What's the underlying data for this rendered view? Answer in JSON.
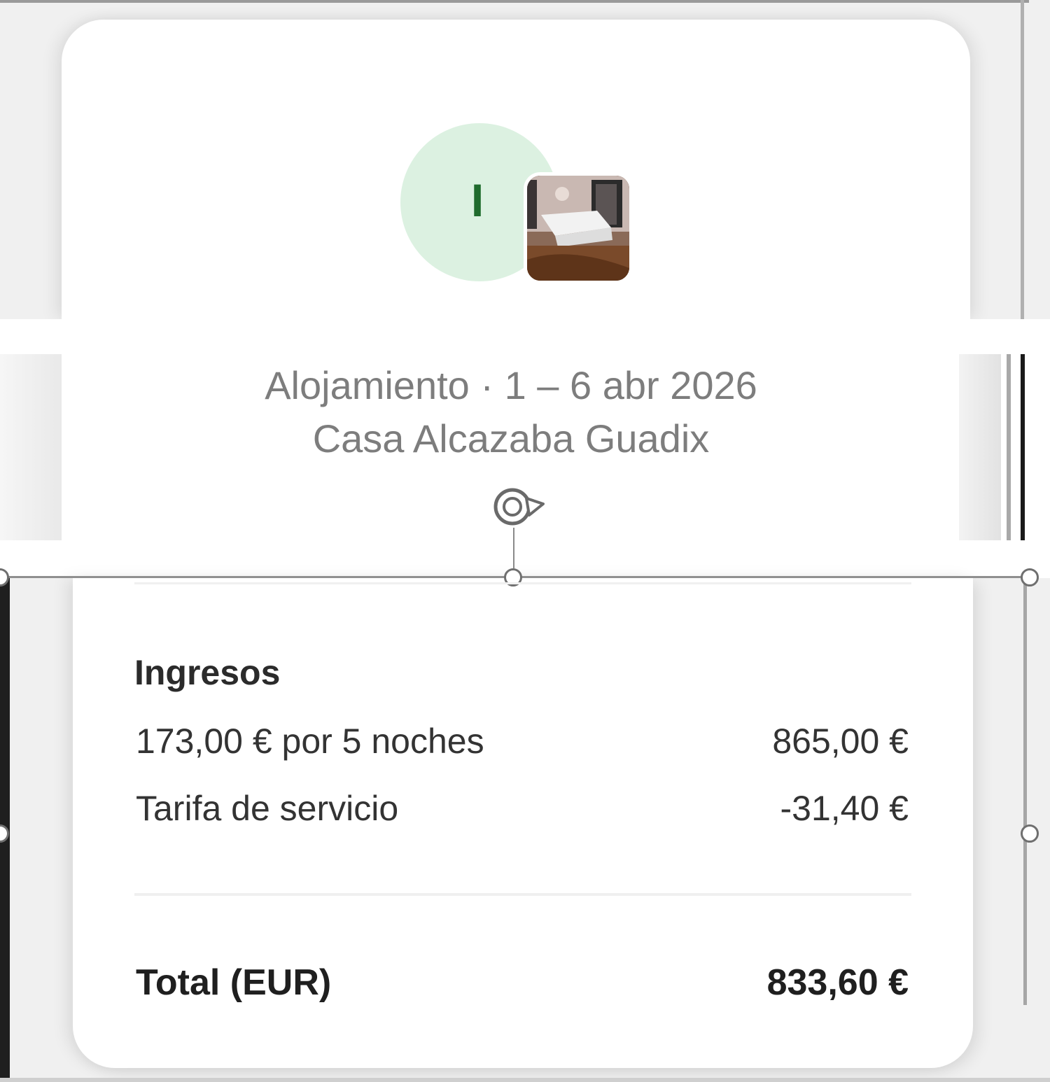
{
  "host": {
    "avatar_initial": "I"
  },
  "reservation": {
    "stay_label": "Alojamiento",
    "separator": "·",
    "dates": "1 – 6 abr 2026",
    "listing_name": "Casa Alcazaba Guadix"
  },
  "earnings": {
    "section_title": "Ingresos",
    "rows": [
      {
        "label": "173,00 € por 5 noches",
        "value": "865,00 €"
      },
      {
        "label": "Tarifa de servicio",
        "value": "-31,40 €"
      }
    ],
    "total_label": "Total (EUR)",
    "total_value": "833,60 €"
  },
  "icons": {
    "rotate": "rotate-icon",
    "listing_photo": "bedroom-photo"
  },
  "colors": {
    "avatar_bg": "#dcf1e1",
    "avatar_letter": "#1f6b2d",
    "muted_text": "#7d7d7d",
    "body_text": "#333333"
  }
}
